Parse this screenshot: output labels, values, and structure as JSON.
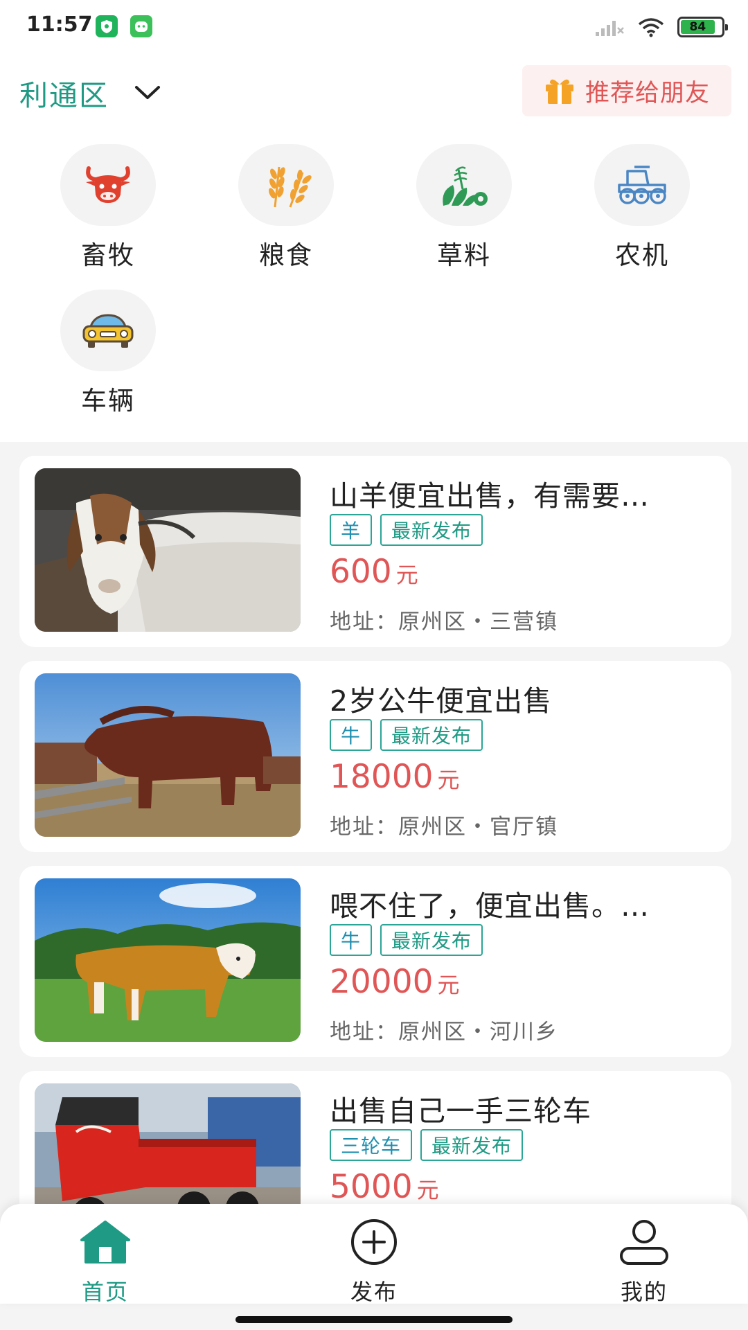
{
  "status_bar": {
    "time": "11:57",
    "battery": "84",
    "icons": [
      "shield-app-icon",
      "cat-app-icon",
      "signal-icon",
      "wifi-icon",
      "battery-icon"
    ]
  },
  "header": {
    "district": "利通区",
    "recommend": "推荐给朋友",
    "colors": {
      "accent": "#1f9a84",
      "recommend_text": "#e05656",
      "recommend_bg": "#fdf0f0"
    }
  },
  "categories": [
    {
      "label": "畜牧",
      "icon": "cow-icon",
      "color": "#e0402e"
    },
    {
      "label": "粮食",
      "icon": "wheat-icon",
      "color": "#f0a131"
    },
    {
      "label": "草料",
      "icon": "grass-icon",
      "color": "#2e9a55"
    },
    {
      "label": "农机",
      "icon": "tractor-icon",
      "color": "#4a86c4"
    },
    {
      "label": "车辆",
      "icon": "car-icon",
      "color": "#f4c430"
    }
  ],
  "listings": [
    {
      "title": "山羊便宜出售，有需要…",
      "tags": [
        "羊",
        "最新发布"
      ],
      "price": "600",
      "unit": "元",
      "address": "地址：原州区・三营镇",
      "image": "goat-photo"
    },
    {
      "title": "2岁公牛便宜出售",
      "tags": [
        "牛",
        "最新发布"
      ],
      "price": "18000",
      "unit": "元",
      "address": "地址：原州区・官厅镇",
      "image": "bull-photo"
    },
    {
      "title": "喂不住了，便宜出售。…",
      "tags": [
        "牛",
        "最新发布"
      ],
      "price": "20000",
      "unit": "元",
      "address": "地址：原州区・河川乡",
      "image": "cow-photo"
    },
    {
      "title": "出售自己一手三轮车",
      "tags": [
        "三轮车",
        "最新发布"
      ],
      "price": "5000",
      "unit": "元",
      "address": "",
      "image": "tricycle-photo"
    }
  ],
  "nav": {
    "items": [
      {
        "label": "首页",
        "icon": "home-icon",
        "active": true
      },
      {
        "label": "发布",
        "icon": "plus-circle-icon",
        "active": false
      },
      {
        "label": "我的",
        "icon": "user-icon",
        "active": false
      }
    ],
    "colors": {
      "active": "#1f9a84",
      "inactive": "#222222"
    }
  },
  "colors": {
    "price": "#e05656",
    "tag_border": "#2aa596",
    "background": "#f4f4f4"
  }
}
